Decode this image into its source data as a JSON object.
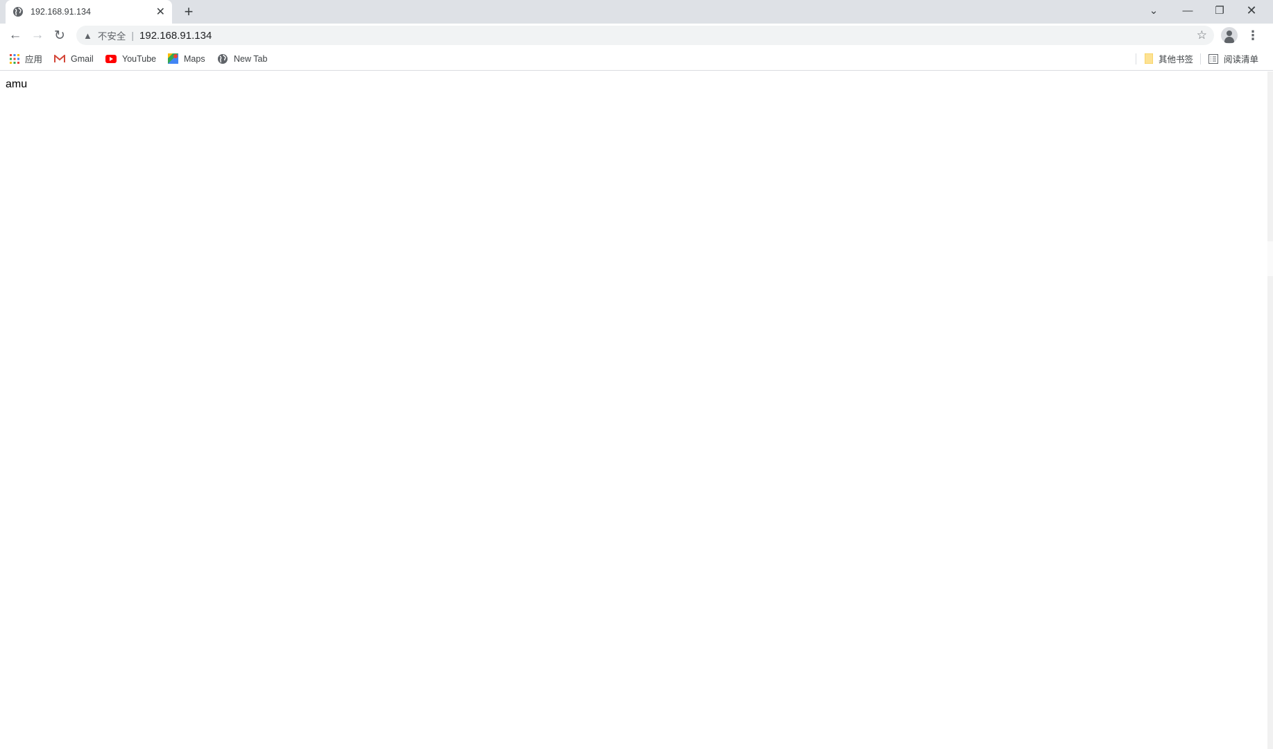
{
  "tab": {
    "title": "192.168.91.134",
    "icon": "globe-icon"
  },
  "toolbar": {
    "security_label": "不安全",
    "separator": "|",
    "url": "192.168.91.134"
  },
  "bookmarks": {
    "items": [
      {
        "label": "应用",
        "icon": "apps-grid-icon"
      },
      {
        "label": "Gmail",
        "icon": "gmail-icon"
      },
      {
        "label": "YouTube",
        "icon": "youtube-icon"
      },
      {
        "label": "Maps",
        "icon": "maps-icon"
      },
      {
        "label": "New Tab",
        "icon": "globe-icon"
      }
    ],
    "other": "其他书签",
    "reading_list": "阅读清单"
  },
  "page": {
    "text": "amu"
  }
}
